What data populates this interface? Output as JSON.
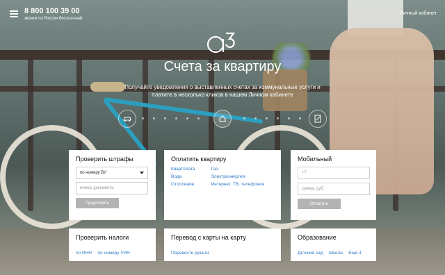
{
  "header": {
    "phone": "8 800 100 39 00",
    "phone_note": "звонок по России бесплатный",
    "cabinet_link": "Личный кабинет"
  },
  "hero": {
    "logo_text": "a3",
    "title": "Счета за квартиру",
    "subtitle": "Получайте уведомления о выставленных счетах за коммунальные услуги и платите в несколько кликов в нашем Личном кабинете"
  },
  "slider_icons": [
    "car-icon",
    "house-icon",
    "document-icon"
  ],
  "cards": {
    "fines": {
      "title": "Проверить штрафы",
      "select_value": "по номеру ВУ",
      "input_placeholder": "номер документа",
      "button": "Продолжить"
    },
    "apartment": {
      "title": "Оплатить квартиру",
      "links": [
        "Квартплата",
        "Газ",
        "Вода",
        "Электроэнергия",
        "Отопление",
        "Интернет, ТВ, телефония"
      ]
    },
    "mobile": {
      "title": "Мобильный",
      "phone_placeholder": "+7",
      "amount_placeholder": "сумма, руб.",
      "button": "Оплатить"
    },
    "taxes": {
      "title": "Проверить налоги",
      "links": [
        "по ИНН",
        "по номеру УИН"
      ]
    },
    "transfer": {
      "title": "Перевод с карты на карту",
      "link": "Перевести деньги"
    },
    "education": {
      "title": "Образование",
      "links": [
        "Детский сад",
        "Школа",
        "Ещё 4"
      ]
    }
  },
  "colors": {
    "link": "#2f7ac9",
    "button_gray": "#b3b3b3"
  }
}
